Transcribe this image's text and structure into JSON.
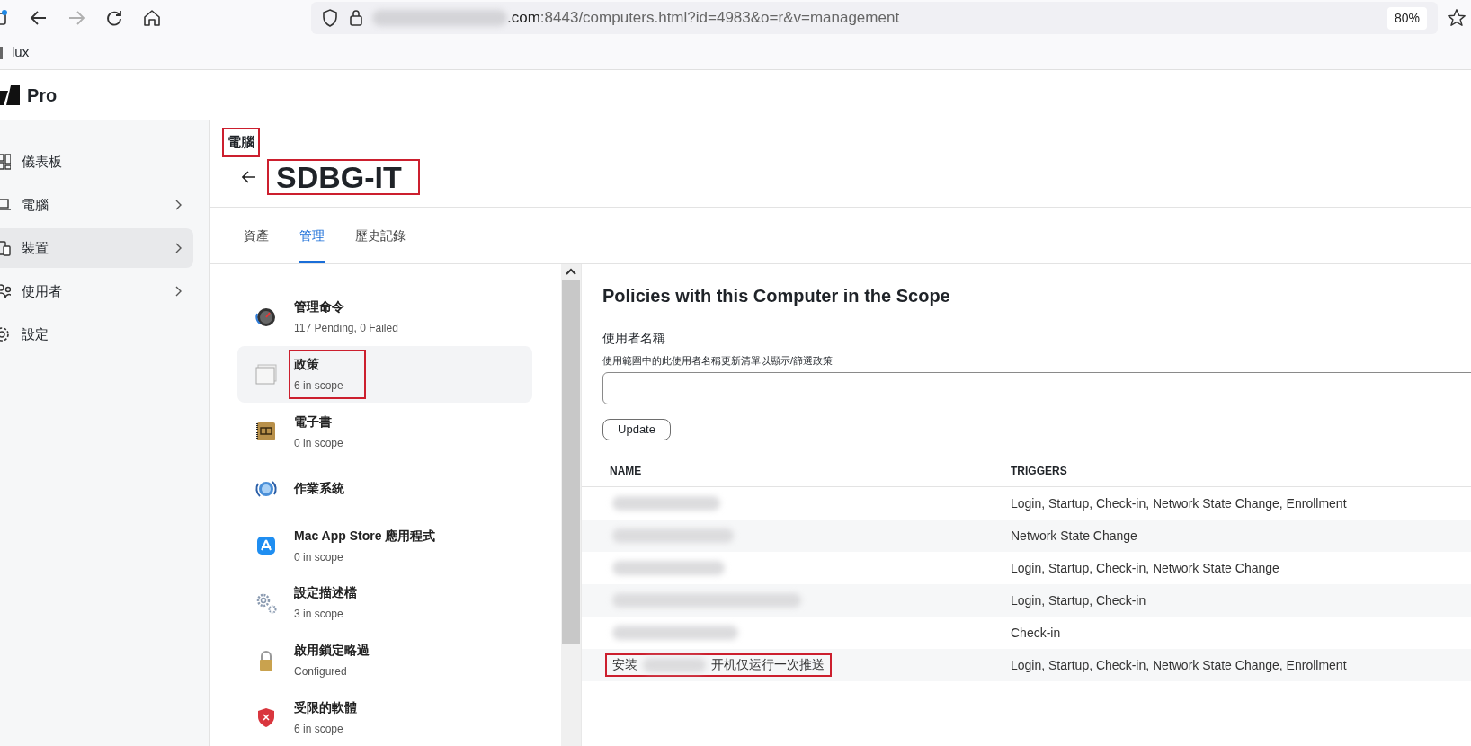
{
  "browser": {
    "nav": [
      {
        "kind": "back",
        "disabled": false
      },
      {
        "kind": "forward",
        "disabled": true
      },
      {
        "kind": "reload",
        "disabled": false
      },
      {
        "kind": "home",
        "disabled": false
      }
    ],
    "address": [
      {
        "kind": "redacted"
      },
      {
        "kind": "text",
        "text": ".com",
        "strong": true
      },
      {
        "kind": "text",
        "text": ":8443/computers.html?id=4983&o=r&v=management",
        "strong": false
      }
    ],
    "zoom": "80%",
    "bookmarks": [
      "lux"
    ]
  },
  "app": {
    "name": "Pro"
  },
  "sidebar": {
    "items": [
      {
        "label": "儀表板",
        "selected": false,
        "expandable": false
      },
      {
        "label": "電腦",
        "selected": false,
        "expandable": true
      },
      {
        "label": "裝置",
        "selected": true,
        "expandable": true
      },
      {
        "label": "使用者",
        "selected": false,
        "expandable": true
      },
      {
        "label": "設定",
        "selected": false,
        "expandable": false
      }
    ]
  },
  "header": {
    "breadcrumb": {
      "text": "電腦",
      "highlighted": true
    },
    "title": {
      "text": "SDBG-IT",
      "highlighted": true
    }
  },
  "tabs": [
    {
      "label": "資產",
      "selected": false
    },
    {
      "label": "管理",
      "selected": true
    },
    {
      "label": "歷史記錄",
      "selected": false
    }
  ],
  "categories": [
    {
      "title": "管理命令",
      "subtitle": "117 Pending, 0 Failed",
      "selected": false,
      "highlighted": false
    },
    {
      "title": "政策",
      "subtitle": "6 in scope",
      "selected": true,
      "highlighted": true
    },
    {
      "title": "電子書",
      "subtitle": "0 in scope",
      "selected": false,
      "highlighted": false
    },
    {
      "title": "作業系統",
      "selected": false,
      "highlighted": false
    },
    {
      "title": "Mac App Store 應用程式",
      "subtitle": "0 in scope",
      "selected": false,
      "highlighted": false
    },
    {
      "title": "設定描述檔",
      "subtitle": "3 in scope",
      "selected": false,
      "highlighted": false
    },
    {
      "title": "啟用鎖定略過",
      "subtitle": "Configured",
      "selected": false,
      "highlighted": false
    },
    {
      "title": "受限的軟體",
      "subtitle": "6 in scope",
      "selected": false,
      "highlighted": false
    }
  ],
  "policies": {
    "heading": "Policies with this Computer in the Scope",
    "field": {
      "label": "使用者名稱",
      "hint": "使用範圍中的此使用者名稱更新清單以顯示/篩選政策"
    },
    "button": "Update",
    "table": {
      "columns": [
        "NAME",
        "TRIGGERS"
      ],
      "rows": [
        {
          "name": [
            {
              "kind": "redacted"
            }
          ],
          "highlighted": false,
          "triggers": "Login, Startup, Check-in, Network State Change, Enrollment"
        },
        {
          "name": [
            {
              "kind": "redacted"
            }
          ],
          "highlighted": false,
          "triggers": "Network State Change"
        },
        {
          "name": [
            {
              "kind": "redacted"
            }
          ],
          "highlighted": false,
          "triggers": "Login, Startup, Check-in, Network State Change"
        },
        {
          "name": [
            {
              "kind": "redacted"
            }
          ],
          "highlighted": false,
          "triggers": "Login, Startup, Check-in"
        },
        {
          "name": [
            {
              "kind": "redacted"
            }
          ],
          "highlighted": false,
          "triggers": "Check-in"
        },
        {
          "name": [
            {
              "kind": "text",
              "text": "安装"
            },
            {
              "kind": "redacted"
            },
            {
              "kind": "text",
              "text": "开机仅运行一次推送"
            }
          ],
          "highlighted": true,
          "triggers": "Login, Startup, Check-in, Network State Change, Enrollment"
        }
      ]
    }
  }
}
